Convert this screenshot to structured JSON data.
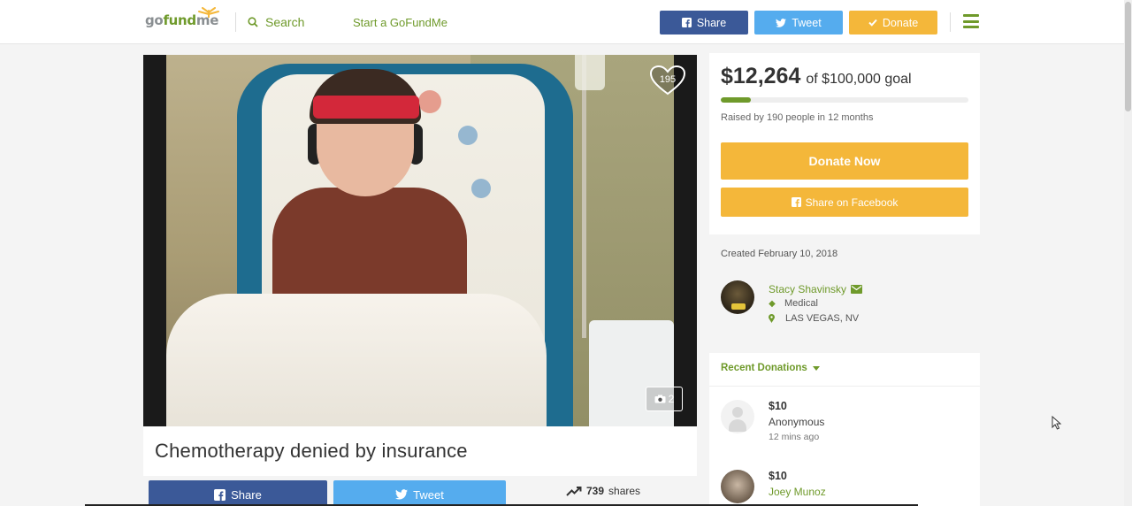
{
  "nav": {
    "logo_go": "go",
    "logo_fund": "fund",
    "logo_me": "me",
    "search_label": "Search",
    "start_label": "Start a GoFundMe",
    "share_label": "Share",
    "tweet_label": "Tweet",
    "donate_label": "Donate"
  },
  "media": {
    "heart_count": "195",
    "photo_count": "2"
  },
  "campaign": {
    "title": "Chemotherapy denied by insurance",
    "share_label": "Share",
    "tweet_label": "Tweet",
    "shares_count": "739",
    "shares_label": "shares"
  },
  "donation": {
    "raised": "$12,264",
    "goal_text": "of $100,000 goal",
    "progress_percent": 12.3,
    "raised_by": "Raised by 190 people in 12 months",
    "donate_now_label": "Donate Now",
    "share_fb_label": "Share on Facebook"
  },
  "organizer": {
    "created": "Created February 10, 2018",
    "name": "Stacy Shavinsky",
    "category": "Medical",
    "location": "LAS VEGAS, NV"
  },
  "recent": {
    "label": "Recent Donations",
    "items": [
      {
        "amount": "$10",
        "name": "Anonymous",
        "time": "12 mins ago"
      },
      {
        "amount": "$10",
        "name": "Joey Munoz",
        "time": ""
      }
    ]
  },
  "colors": {
    "brand_green": "#6f9a2b",
    "facebook_blue": "#3b5998",
    "twitter_blue": "#55acee",
    "donate_yellow": "#f4b73a"
  },
  "icons": [
    "search-icon",
    "facebook-icon",
    "twitter-icon",
    "check-icon",
    "menu-icon",
    "heart-icon",
    "camera-icon",
    "trending-icon",
    "email-icon",
    "tag-icon",
    "map-pin-icon",
    "chevron-down-icon"
  ]
}
